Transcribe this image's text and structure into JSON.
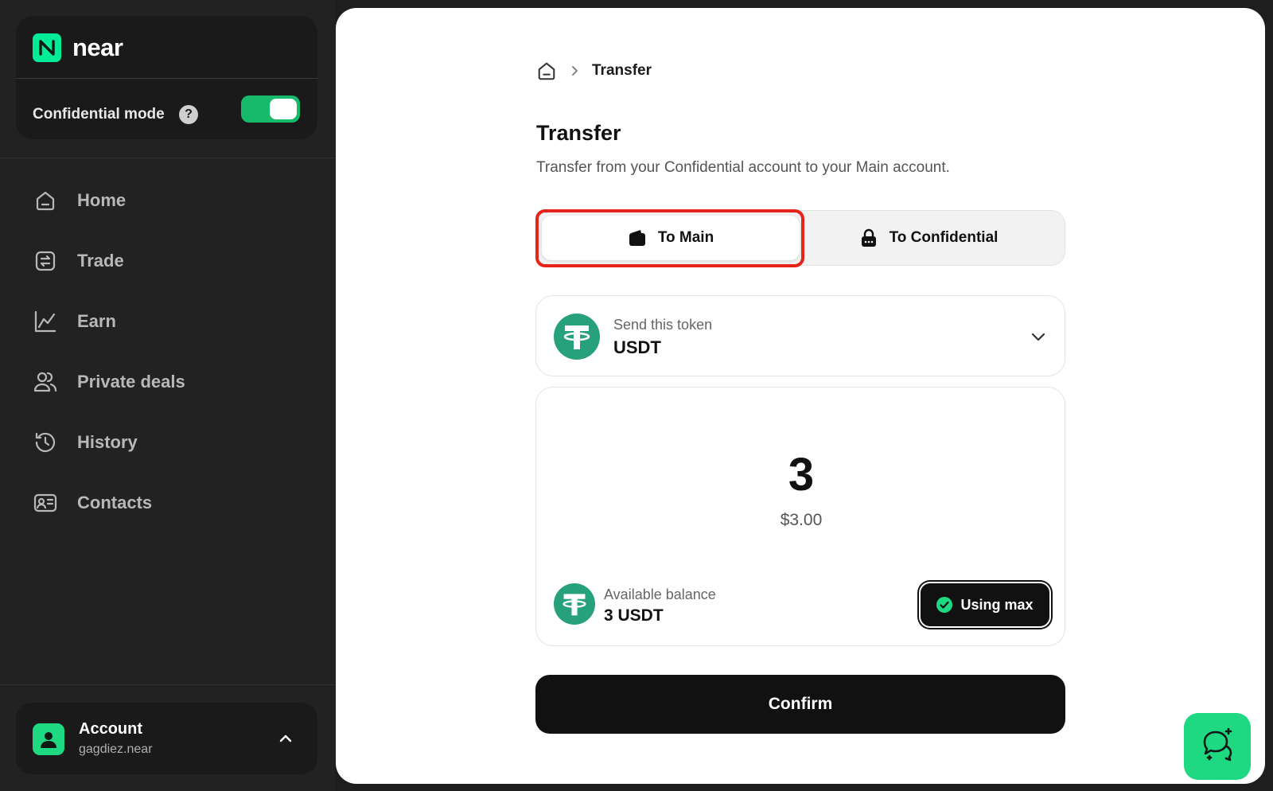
{
  "brand": {
    "name": "near",
    "icon": "near-logo-icon",
    "accent": "#00ec97"
  },
  "confidential_mode": {
    "label": "Confidential mode",
    "help": "?",
    "enabled": true,
    "toggle_color": "#17b96b"
  },
  "nav": {
    "items": [
      {
        "label": "Home",
        "icon": "home-icon"
      },
      {
        "label": "Trade",
        "icon": "trade-icon"
      },
      {
        "label": "Earn",
        "icon": "chart-line-icon"
      },
      {
        "label": "Private deals",
        "icon": "users-icon"
      },
      {
        "label": "History",
        "icon": "history-icon"
      },
      {
        "label": "Contacts",
        "icon": "contact-card-icon"
      }
    ]
  },
  "account": {
    "title": "Account",
    "subtitle": "gagdiez.near"
  },
  "breadcrumb": {
    "current": "Transfer"
  },
  "page": {
    "title": "Transfer",
    "subtitle": "Transfer from your Confidential account to your Main account."
  },
  "direction": {
    "options": [
      {
        "label": "To Main",
        "icon": "wallet-icon",
        "selected": true
      },
      {
        "label": "To Confidential",
        "icon": "lock-icon",
        "selected": false
      }
    ],
    "highlight_color": "#e8241a"
  },
  "token": {
    "caption": "Send this token",
    "symbol": "USDT",
    "color": "#26a17b"
  },
  "amount": {
    "value": "3",
    "usd": "$3.00",
    "balance_caption": "Available balance",
    "balance_value": "3 USDT",
    "max_label": "Using max"
  },
  "confirm_label": "Confirm",
  "chat": {
    "icon": "chat-sparkle-icon",
    "color": "#1ed882"
  }
}
